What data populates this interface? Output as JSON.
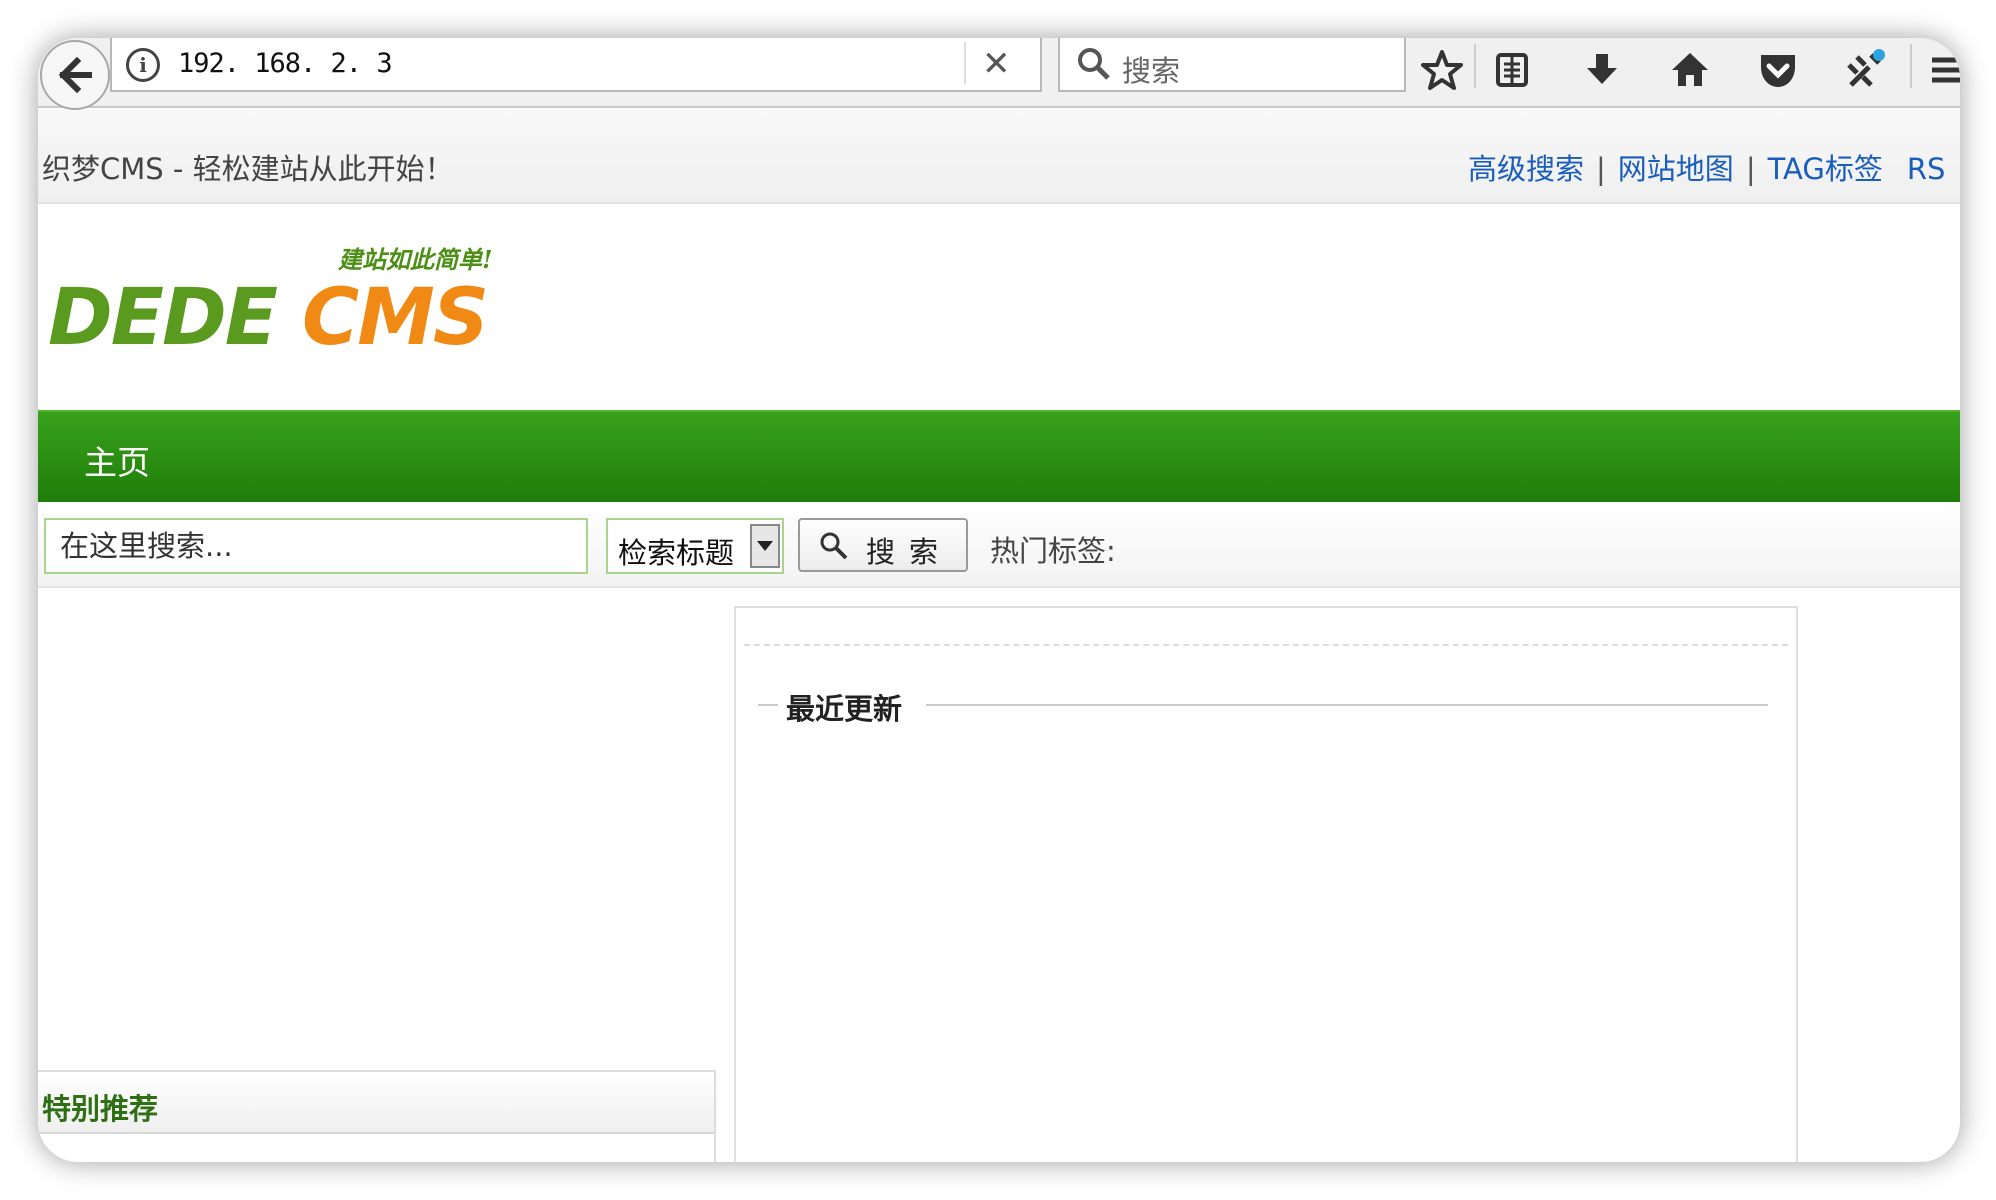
{
  "browser": {
    "url": "192. 168. 2. 3",
    "search_placeholder": "搜索",
    "icons": [
      "back-arrow-icon",
      "info-icon",
      "clear-icon",
      "search-icon",
      "bookmark-star-icon",
      "reader-icon",
      "download-icon",
      "home-icon",
      "pocket-icon",
      "extension-icon",
      "menu-icon"
    ]
  },
  "site": {
    "slogan": "织梦CMS - 轻松建站从此开始！",
    "top_links": [
      {
        "label": "高级搜索"
      },
      {
        "label": "网站地图"
      },
      {
        "label": "TAG标签"
      },
      {
        "label": "RS"
      }
    ],
    "link_separator": "|",
    "logo": {
      "main_left": "DEDE",
      "main_right": "CMS",
      "tagline": "建站如此简单!"
    },
    "colors": {
      "nav_green": "#2a8f12",
      "logo_green": "#5a9a1e",
      "logo_orange": "#f08a14",
      "link_blue": "#1a5dbd"
    }
  },
  "nav": {
    "items": [
      {
        "label": "主页"
      }
    ]
  },
  "search": {
    "placeholder_value": "在这里搜索...",
    "field_select": "检索标题",
    "button_label": "搜索",
    "hot_tags_label": "热门标签:"
  },
  "content": {
    "recent_title": "最近更新",
    "featured_title": "特别推荐"
  }
}
